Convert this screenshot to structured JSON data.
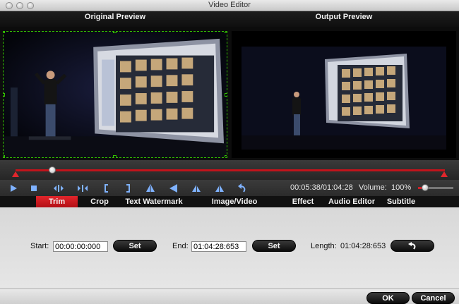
{
  "window": {
    "title": "Video Editor"
  },
  "preview": {
    "original_label": "Original Preview",
    "output_label": "Output Preview"
  },
  "controls": {
    "icons": [
      "play-icon",
      "stop-icon",
      "previous-frame-icon",
      "next-frame-icon",
      "mark-in-icon",
      "mark-out-icon",
      "flip-vertical-icon",
      "flip-horizontal-icon",
      "rotate-left-icon",
      "rotate-right-icon",
      "undo-icon"
    ],
    "time": "00:05:38/01:04:28",
    "volume_label": "Volume:",
    "volume_value": "100%",
    "volume_level": 0.2,
    "timeline_position": 0.085
  },
  "tabs": [
    {
      "label": "Trim",
      "active": true
    },
    {
      "label": "Crop"
    },
    {
      "label": "Text Watermark"
    },
    {
      "label": "Image/Video Watermark"
    },
    {
      "label": "Effect"
    },
    {
      "label": "Audio Editor"
    },
    {
      "label": "Subtitle"
    }
  ],
  "trim": {
    "start_label": "Start:",
    "start_value": "00:00:00:000",
    "set_label": "Set",
    "end_label": "End:",
    "end_value": "01:04:28:653",
    "length_label": "Length:",
    "length_value": "01:04:28:653"
  },
  "footer": {
    "ok_label": "OK",
    "cancel_label": "Cancel"
  },
  "colors": {
    "accent_red": "#d02028",
    "crop_green": "#34c000",
    "icon_blue": "#7fb2ff"
  }
}
